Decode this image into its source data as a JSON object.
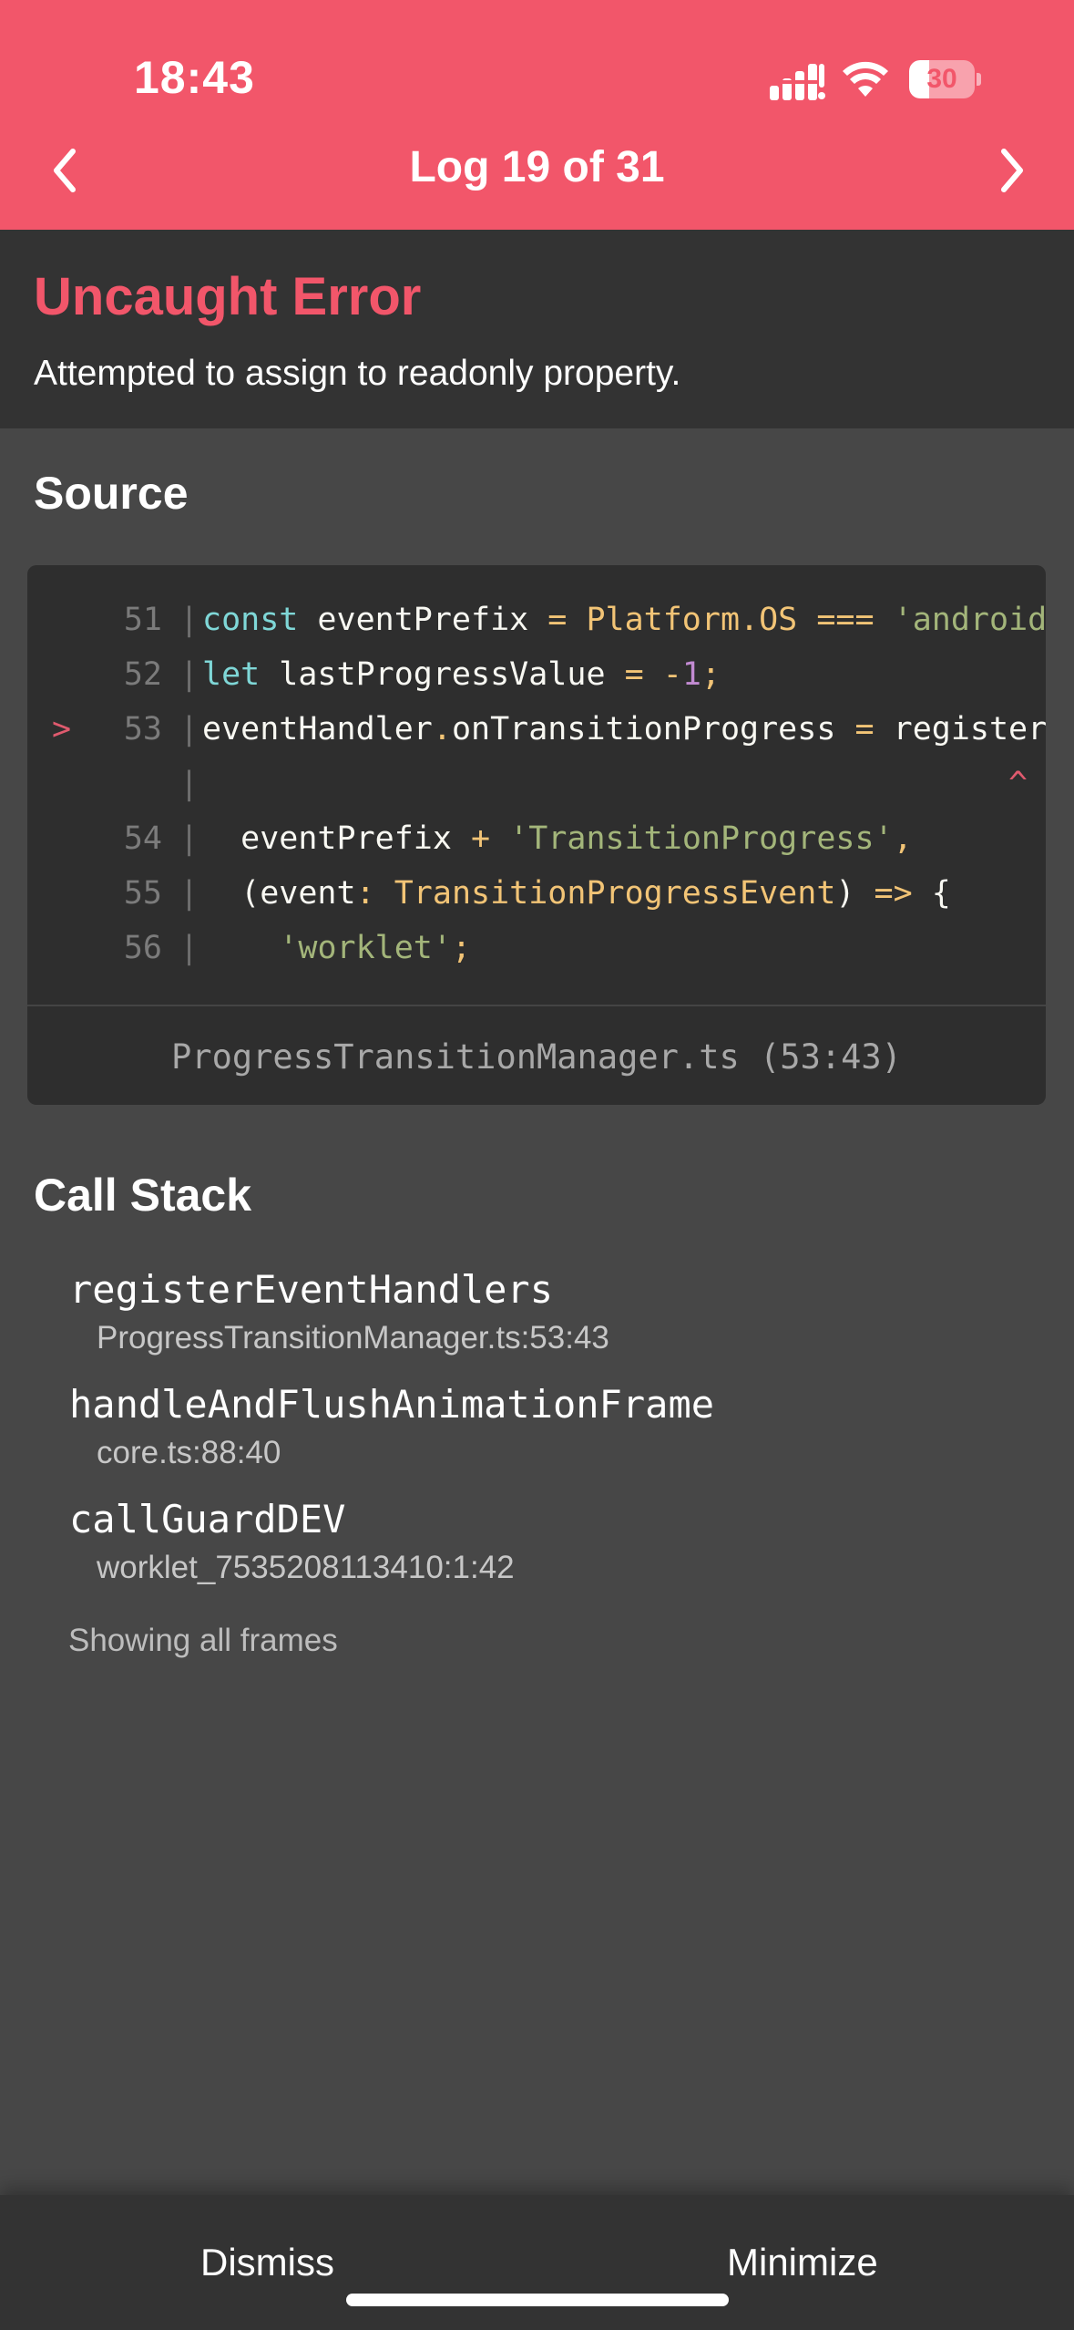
{
  "status": {
    "time": "18:43",
    "battery_percent": "30",
    "battery_level": 0.3
  },
  "header": {
    "title": "Log 19 of 31",
    "background": "#f2566a"
  },
  "error": {
    "title": "Uncaught Error",
    "message": "Attempted to assign to readonly property."
  },
  "source": {
    "title": "Source",
    "lines": [
      {
        "number": "51",
        "marker": "",
        "tokens": [
          {
            "t": "const",
            "c": "kw"
          },
          {
            "t": " eventPrefix ",
            "c": ""
          },
          {
            "t": "=",
            "c": "op"
          },
          {
            "t": " ",
            "c": ""
          },
          {
            "t": "Platform",
            "c": "tp"
          },
          {
            "t": ".",
            "c": "op"
          },
          {
            "t": "OS",
            "c": "tp"
          },
          {
            "t": " ",
            "c": ""
          },
          {
            "t": "===",
            "c": "op"
          },
          {
            "t": " ",
            "c": ""
          },
          {
            "t": "'android'",
            "c": "str"
          }
        ]
      },
      {
        "number": "52",
        "marker": "",
        "tokens": [
          {
            "t": "let",
            "c": "kw"
          },
          {
            "t": " lastProgressValue ",
            "c": ""
          },
          {
            "t": "=",
            "c": "op"
          },
          {
            "t": " ",
            "c": ""
          },
          {
            "t": "-",
            "c": "op"
          },
          {
            "t": "1",
            "c": "num"
          },
          {
            "t": ";",
            "c": "op"
          }
        ]
      },
      {
        "number": "53",
        "marker": ">",
        "tokens": [
          {
            "t": "eventHandler",
            "c": ""
          },
          {
            "t": ".",
            "c": "op"
          },
          {
            "t": "onTransitionProgress ",
            "c": ""
          },
          {
            "t": "=",
            "c": "op"
          },
          {
            "t": " registerEventHandlers(",
            "c": ""
          }
        ]
      },
      {
        "number": "",
        "marker": "",
        "tokens": [
          {
            "t": "                                          ^",
            "c": "caret"
          }
        ]
      },
      {
        "number": "54",
        "marker": "",
        "tokens": [
          {
            "t": "  eventPrefix ",
            "c": ""
          },
          {
            "t": "+",
            "c": "op"
          },
          {
            "t": " ",
            "c": ""
          },
          {
            "t": "'TransitionProgress'",
            "c": "str"
          },
          {
            "t": ",",
            "c": "op"
          }
        ]
      },
      {
        "number": "55",
        "marker": "",
        "tokens": [
          {
            "t": "  (event",
            "c": ""
          },
          {
            "t": ":",
            "c": "op"
          },
          {
            "t": " ",
            "c": ""
          },
          {
            "t": "TransitionProgressEvent",
            "c": "tp"
          },
          {
            "t": ") ",
            "c": ""
          },
          {
            "t": "=>",
            "c": "op"
          },
          {
            "t": " {",
            "c": ""
          }
        ]
      },
      {
        "number": "56",
        "marker": "",
        "tokens": [
          {
            "t": "    ",
            "c": ""
          },
          {
            "t": "'worklet'",
            "c": "str"
          },
          {
            "t": ";",
            "c": "op"
          }
        ]
      }
    ],
    "file_location": "ProgressTransitionManager.ts (53:43)"
  },
  "call_stack": {
    "title": "Call Stack",
    "frames": [
      {
        "name": "registerEventHandlers",
        "location": "ProgressTransitionManager.ts:53:43"
      },
      {
        "name": "handleAndFlushAnimationFrame",
        "location": "core.ts:88:40"
      },
      {
        "name": "callGuardDEV",
        "location": "worklet_7535208113410:1:42"
      }
    ],
    "toggle_label": "Showing all frames"
  },
  "footer": {
    "dismiss_label": "Dismiss",
    "minimize_label": "Minimize"
  },
  "icons": {
    "prev": "chevron-left-icon",
    "next": "chevron-right-icon",
    "signal": "cellular-signal-icon",
    "wifi": "wifi-icon",
    "battery": "battery-icon"
  }
}
